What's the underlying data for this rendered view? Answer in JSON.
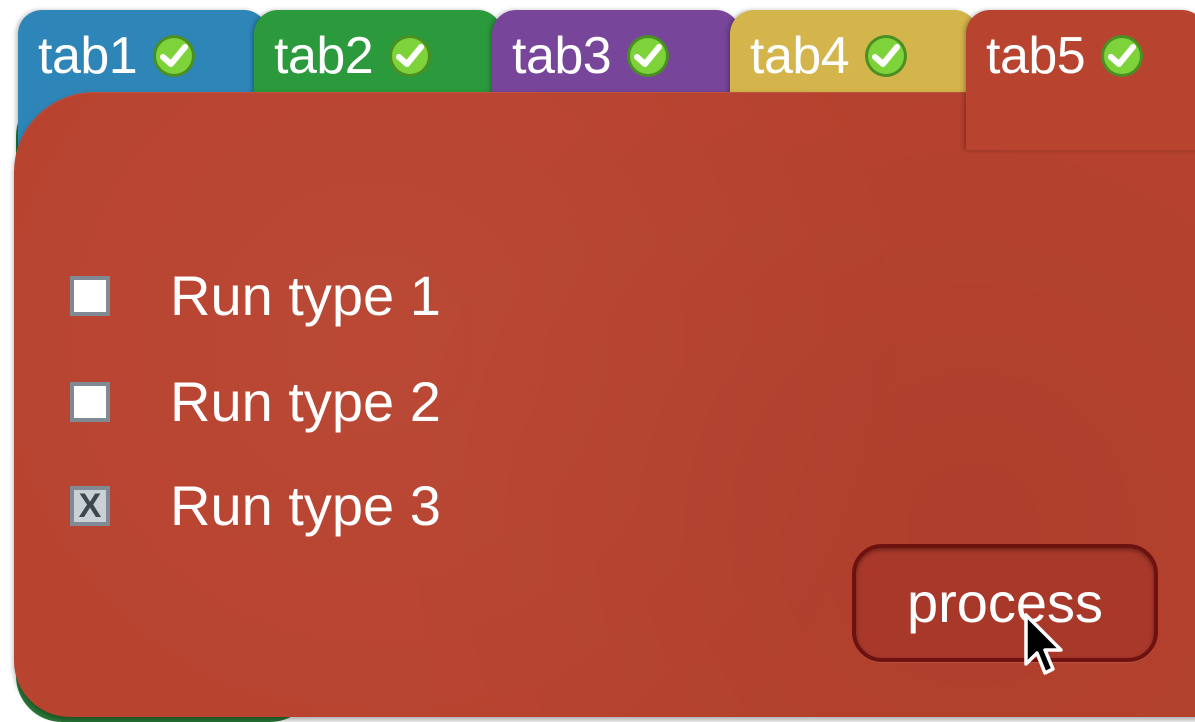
{
  "tabs": [
    {
      "label": "tab1",
      "status": "complete",
      "color": "#2e86b8"
    },
    {
      "label": "tab2",
      "status": "complete",
      "color": "#2a9a3c"
    },
    {
      "label": "tab3",
      "status": "complete",
      "color": "#77459a"
    },
    {
      "label": "tab4",
      "status": "complete",
      "color": "#d4b54b"
    },
    {
      "label": "tab5",
      "status": "complete",
      "color": "#b8432f"
    }
  ],
  "active_tab": "tab5",
  "status_icon": "green-check-icon",
  "options": [
    {
      "label": "Run type 1",
      "checked": false,
      "mark": ""
    },
    {
      "label": "Run type 2",
      "checked": false,
      "mark": ""
    },
    {
      "label": "Run type 3",
      "checked": true,
      "mark": "X"
    }
  ],
  "process_button": {
    "label": "process"
  },
  "panel_color": "#b8432f"
}
